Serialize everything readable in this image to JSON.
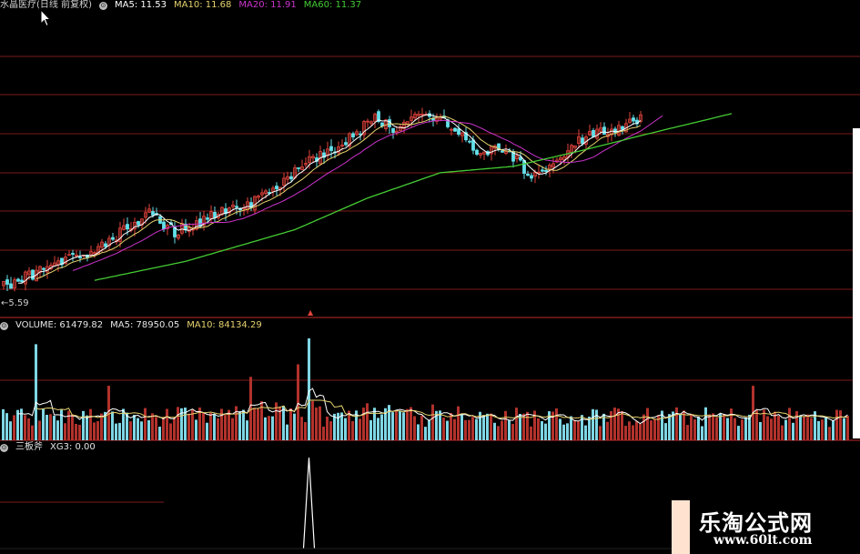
{
  "header": {
    "stock_title": "水晶医疗(日线 前复权)",
    "ma5_label": "MA5: 11.53",
    "ma10_label": "MA10: 11.68",
    "ma20_label": "MA20: 11.91",
    "ma60_label": "MA60: 11.37"
  },
  "price_panel": {
    "low_marker": "5.59"
  },
  "volume_panel": {
    "volume_label": "VOLUME: 61479.82",
    "ma5_label": "MA5: 78950.05",
    "ma10_label": "MA10: 84134.29"
  },
  "indicator_panel": {
    "name": "三板斧",
    "xg3_label": "XG3: 0.00"
  },
  "watermark": {
    "title": "乐淘公式网",
    "url": "www.60lt.com"
  },
  "colors": {
    "up": "#e0433b",
    "down": "#63e0ea",
    "ma5": "#ffffff",
    "ma10": "#e6d26e",
    "ma20": "#cc33cc",
    "ma60": "#44cc33",
    "grid": "#7a1a1a"
  },
  "chart_data": [
    {
      "type": "candlestick",
      "title": "水晶医疗(日线 前复权)",
      "series": [
        {
          "name": "MA5",
          "last": 11.53
        },
        {
          "name": "MA10",
          "last": 11.68
        },
        {
          "name": "MA20",
          "last": 11.91
        },
        {
          "name": "MA60",
          "last": 11.37
        }
      ],
      "price_anchors": [
        {
          "x": 0,
          "y": 5.8
        },
        {
          "x": 15,
          "y": 6.9
        },
        {
          "x": 25,
          "y": 7.5
        },
        {
          "x": 40,
          "y": 9.3
        },
        {
          "x": 47,
          "y": 8.4
        },
        {
          "x": 60,
          "y": 9.3
        },
        {
          "x": 70,
          "y": 9.9
        },
        {
          "x": 80,
          "y": 11.3
        },
        {
          "x": 92,
          "y": 12.5
        },
        {
          "x": 97,
          "y": 13.1
        },
        {
          "x": 102,
          "y": 13.8
        },
        {
          "x": 108,
          "y": 13.2
        },
        {
          "x": 115,
          "y": 13.9
        },
        {
          "x": 122,
          "y": 13.6
        },
        {
          "x": 130,
          "y": 12.1
        },
        {
          "x": 138,
          "y": 12.4
        },
        {
          "x": 144,
          "y": 11.1
        },
        {
          "x": 150,
          "y": 11.4
        },
        {
          "x": 158,
          "y": 12.7
        },
        {
          "x": 168,
          "y": 13.3
        },
        {
          "x": 175,
          "y": 13.8
        }
      ],
      "ma60_anchors": [
        {
          "x": 25,
          "y": 6.1
        },
        {
          "x": 50,
          "y": 7.0
        },
        {
          "x": 80,
          "y": 8.5
        },
        {
          "x": 100,
          "y": 10.0
        },
        {
          "x": 120,
          "y": 11.2
        },
        {
          "x": 140,
          "y": 11.5
        },
        {
          "x": 160,
          "y": 12.3
        },
        {
          "x": 176,
          "y": 13.0
        },
        {
          "x": 200,
          "y": 14.0
        }
      ],
      "low_marker": 5.59
    },
    {
      "type": "bar",
      "title": "VOLUME",
      "series": [
        {
          "name": "VOLUME",
          "last": 61479.82
        },
        {
          "name": "MA5",
          "last": 78950.05
        },
        {
          "name": "MA10",
          "last": 84134.29
        }
      ],
      "spikes": [
        {
          "x": 9,
          "y": 215000
        },
        {
          "x": 84,
          "y": 228000
        },
        {
          "x": 81,
          "y": 170000
        },
        {
          "x": 68,
          "y": 142000
        },
        {
          "x": 29,
          "y": 122000
        },
        {
          "x": 206,
          "y": 122000
        }
      ]
    },
    {
      "type": "line",
      "title": "三板斧",
      "series": [
        {
          "name": "XG3",
          "last": 0.0
        }
      ],
      "spike_at_x": 84,
      "spike_value": 1.0
    }
  ]
}
